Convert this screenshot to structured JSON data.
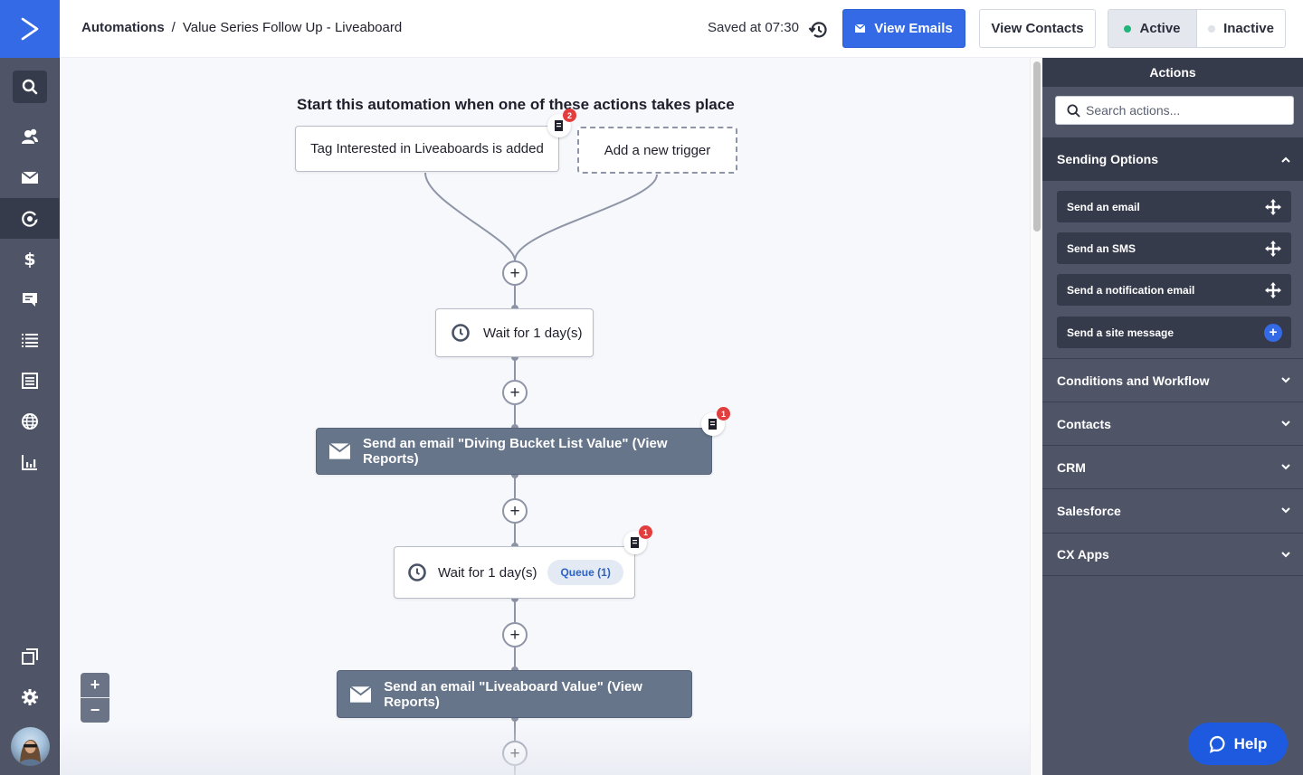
{
  "header": {
    "breadcrumb_root": "Automations",
    "breadcrumb_sep": "/",
    "breadcrumb_current": "Value Series Follow Up - Liveaboard",
    "saved_text": "Saved at 07:30",
    "view_emails_label": "View Emails",
    "view_contacts_label": "View Contacts",
    "status_toggle": {
      "active_label": "Active",
      "inactive_label": "Inactive",
      "selected": "Active",
      "active_dot_color": "#22b57a",
      "inactive_dot_color": "#dfe2e8"
    }
  },
  "leftnav": {
    "items": [
      {
        "icon": "search-icon"
      },
      {
        "icon": "contacts-icon"
      },
      {
        "icon": "email-icon"
      },
      {
        "icon": "automations-icon",
        "active": true
      },
      {
        "icon": "deals-dollar-icon"
      },
      {
        "icon": "conversations-icon"
      },
      {
        "icon": "lists-icon"
      },
      {
        "icon": "forms-icon"
      },
      {
        "icon": "website-globe-icon"
      },
      {
        "icon": "reports-chart-icon"
      },
      {
        "icon": "apps-windows-icon"
      },
      {
        "icon": "settings-gear-icon"
      },
      {
        "icon": "user-avatar"
      }
    ]
  },
  "canvas": {
    "start_title": "Start this automation when one of these actions takes place",
    "trigger_label": "Tag Interested in Liveaboards is added",
    "trigger_badge": "2",
    "add_trigger_label": "Add a new trigger",
    "steps": [
      {
        "type": "wait",
        "label": "Wait for 1 day(s)"
      },
      {
        "type": "email",
        "label": "Send an email \"Diving Bucket List Value\" (View Reports)",
        "badge": "1"
      },
      {
        "type": "wait",
        "label": "Wait for 1 day(s)",
        "queue_label": "Queue (1)",
        "badge": "1"
      },
      {
        "type": "email",
        "label": "Send an email \"Liveaboard Value\" (View Reports)"
      }
    ],
    "plus_symbol": "+",
    "zoom_in": "+",
    "zoom_out": "−"
  },
  "panel": {
    "title": "Actions",
    "search_placeholder": "Search actions...",
    "open_section": {
      "label": "Sending Options",
      "items": [
        {
          "label": "Send an email",
          "icon": "move-icon"
        },
        {
          "label": "Send an SMS",
          "icon": "move-icon"
        },
        {
          "label": "Send a notification email",
          "icon": "move-icon"
        },
        {
          "label": "Send a site message",
          "icon": "add-icon"
        }
      ]
    },
    "sections": [
      {
        "label": "Conditions and Workflow"
      },
      {
        "label": "Contacts"
      },
      {
        "label": "CRM"
      },
      {
        "label": "Salesforce"
      },
      {
        "label": "CX Apps"
      }
    ]
  },
  "help": {
    "label": "Help"
  },
  "colors": {
    "brand_blue": "#356ae6",
    "nav_bg": "#4f5567",
    "nav_active": "#363b4c",
    "email_node": "#66758a",
    "badge_red": "#e23e3e"
  }
}
